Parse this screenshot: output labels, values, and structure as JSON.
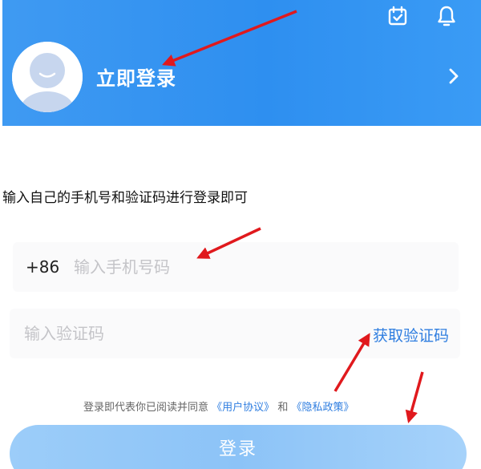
{
  "header": {
    "login_link": "立即登录",
    "icons": [
      "calendar-check-icon",
      "bell-icon",
      "avatar-icon",
      "chevron-right-icon"
    ]
  },
  "instruction": "输入自己的手机号和验证码进行登录即可",
  "phone_field": {
    "country_code": "+86",
    "placeholder": "输入手机号码",
    "value": ""
  },
  "code_field": {
    "placeholder": "输入验证码",
    "value": "",
    "get_code_label": "获取验证码"
  },
  "agreement": {
    "prefix": "登录即代表你已阅读并同意",
    "user_agreement": "《用户协议》",
    "conjunction": "和",
    "privacy_policy": "《隐私政策》"
  },
  "login_button": "登录",
  "colors": {
    "banner": "#2e8ff0",
    "link": "#2f7ee0",
    "button": "#8cc3f7",
    "annotation_arrow": "#e0191d"
  }
}
